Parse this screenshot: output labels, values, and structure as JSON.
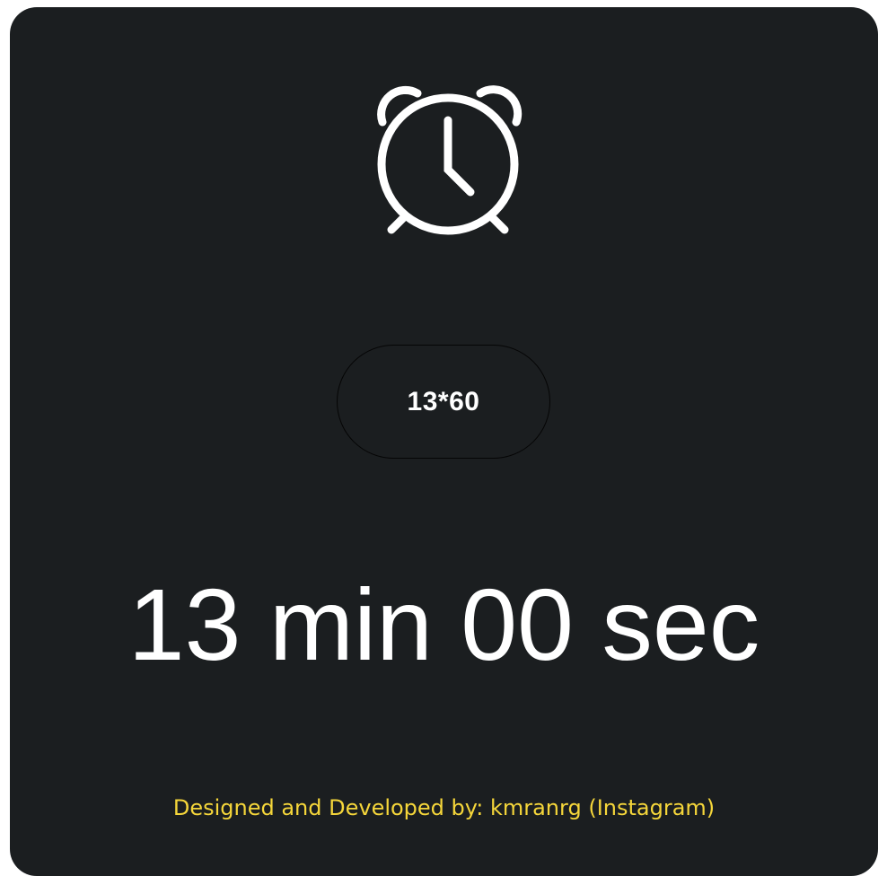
{
  "header": {
    "icon": "alarm-clock-icon"
  },
  "expression_button": {
    "label": "13*60"
  },
  "timer": {
    "display": "13 min 00 sec"
  },
  "footer": {
    "credit": "Designed and Developed by: kmranrg (Instagram)"
  },
  "colors": {
    "background": "#ffffff",
    "card": "#1b1e20",
    "text": "#ffffff",
    "accent": "#f5d63a"
  }
}
